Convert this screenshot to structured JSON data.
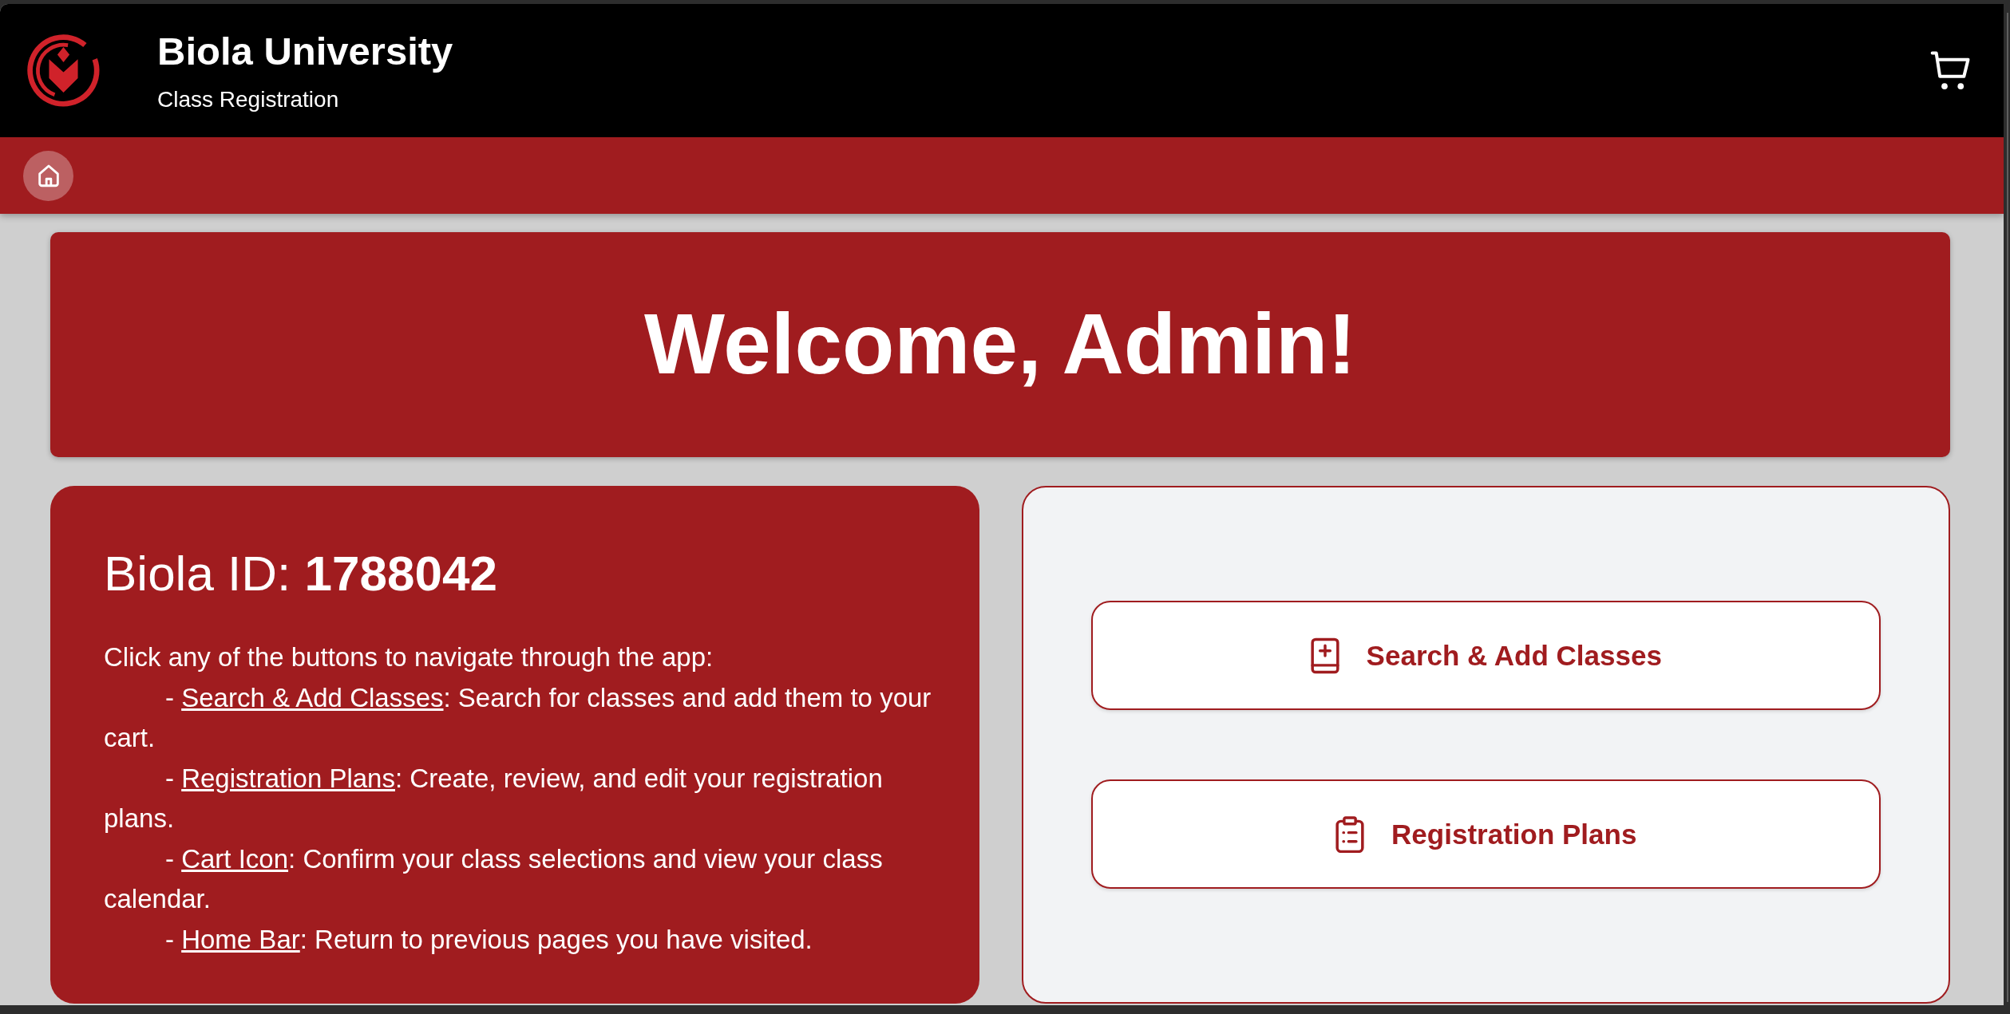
{
  "header": {
    "title": "Biola University",
    "subtitle": "Class Registration"
  },
  "welcome": {
    "heading": "Welcome, Admin!"
  },
  "info": {
    "heading": "Biola ID: **1788042**",
    "intro": "Click any of the buttons to navigate through the app:",
    "items": [
      {
        "bullet": "-",
        "link": "Search & Add Classes",
        "text": ": Search for classes and add them to your cart."
      },
      {
        "bullet": "-",
        "link": "Registration Plans",
        "text": ": Create, review, and edit your registration plans."
      },
      {
        "bullet": "-",
        "link": "Cart Icon",
        "text": ": Confirm your class selections and view your class calendar."
      },
      {
        "bullet": "-",
        "link": "Home Bar",
        "text": ": Return to previous pages you have visited."
      }
    ]
  },
  "actions": [
    {
      "kind": "search",
      "label": "Search & Add Classes"
    },
    {
      "kind": "plans",
      "label": "Registration Plans"
    }
  ]
}
